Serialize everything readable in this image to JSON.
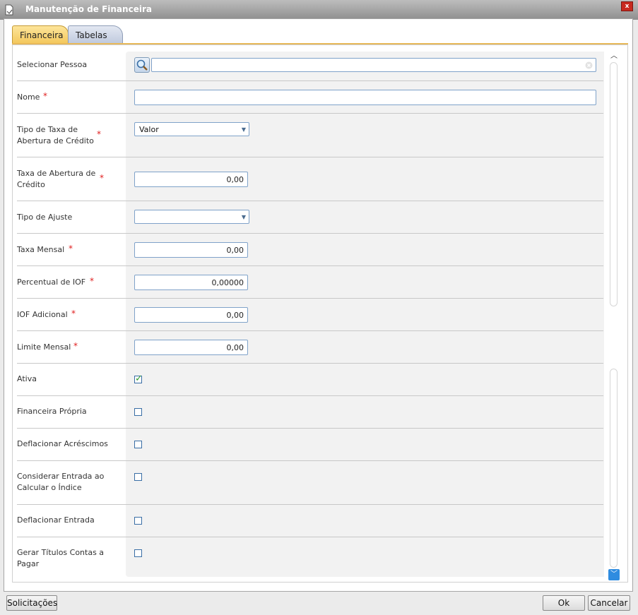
{
  "window": {
    "title": "Manutenção de Financeira",
    "close_label": "x"
  },
  "tabs": [
    {
      "label": "Financeira",
      "active": true
    },
    {
      "label": "Tabelas",
      "active": false
    }
  ],
  "fields": {
    "selecionar_pessoa": {
      "label": "Selecionar Pessoa",
      "value": ""
    },
    "nome": {
      "label": "Nome",
      "value": ""
    },
    "tipo_taxa": {
      "label_line1": "Tipo de Taxa de",
      "label_line2": "Abertura de Crédito",
      "value": "Valor"
    },
    "taxa_abertura": {
      "label_line1": "Taxa de Abertura de",
      "label_line2": "Crédito",
      "value": "0,00"
    },
    "tipo_ajuste": {
      "label": "Tipo de Ajuste",
      "value": ""
    },
    "taxa_mensal": {
      "label": "Taxa Mensal",
      "value": "0,00"
    },
    "percentual_iof": {
      "label": "Percentual de IOF",
      "value": "0,00000"
    },
    "iof_adicional": {
      "label": "IOF Adicional",
      "value": "0,00"
    },
    "limite_mensal": {
      "label": "Limite Mensal",
      "value": "0,00"
    },
    "ativa": {
      "label": "Ativa",
      "checked": true
    },
    "financeira_propria": {
      "label": "Financeira Própria",
      "checked": false
    },
    "deflacionar_acrescimos": {
      "label": "Deflacionar Acréscimos",
      "checked": false
    },
    "considerar_entrada": {
      "label_line1": "Considerar Entrada ao",
      "label_line2": "Calcular o Índice",
      "checked": false
    },
    "deflacionar_entrada": {
      "label": "Deflacionar Entrada",
      "checked": false
    },
    "gerar_titulos": {
      "label_line1": "Gerar Títulos Contas a",
      "label_line2": "Pagar",
      "checked": false
    }
  },
  "required_marker": "*",
  "footer": {
    "solicitacoes": "Solicitações",
    "ok": "Ok",
    "cancelar": "Cancelar"
  },
  "colors": {
    "required": "#e02020",
    "tab_active": "#f3c75b",
    "scroll_down": "#2f8ce0",
    "checkmark": "#2e9b2e"
  }
}
